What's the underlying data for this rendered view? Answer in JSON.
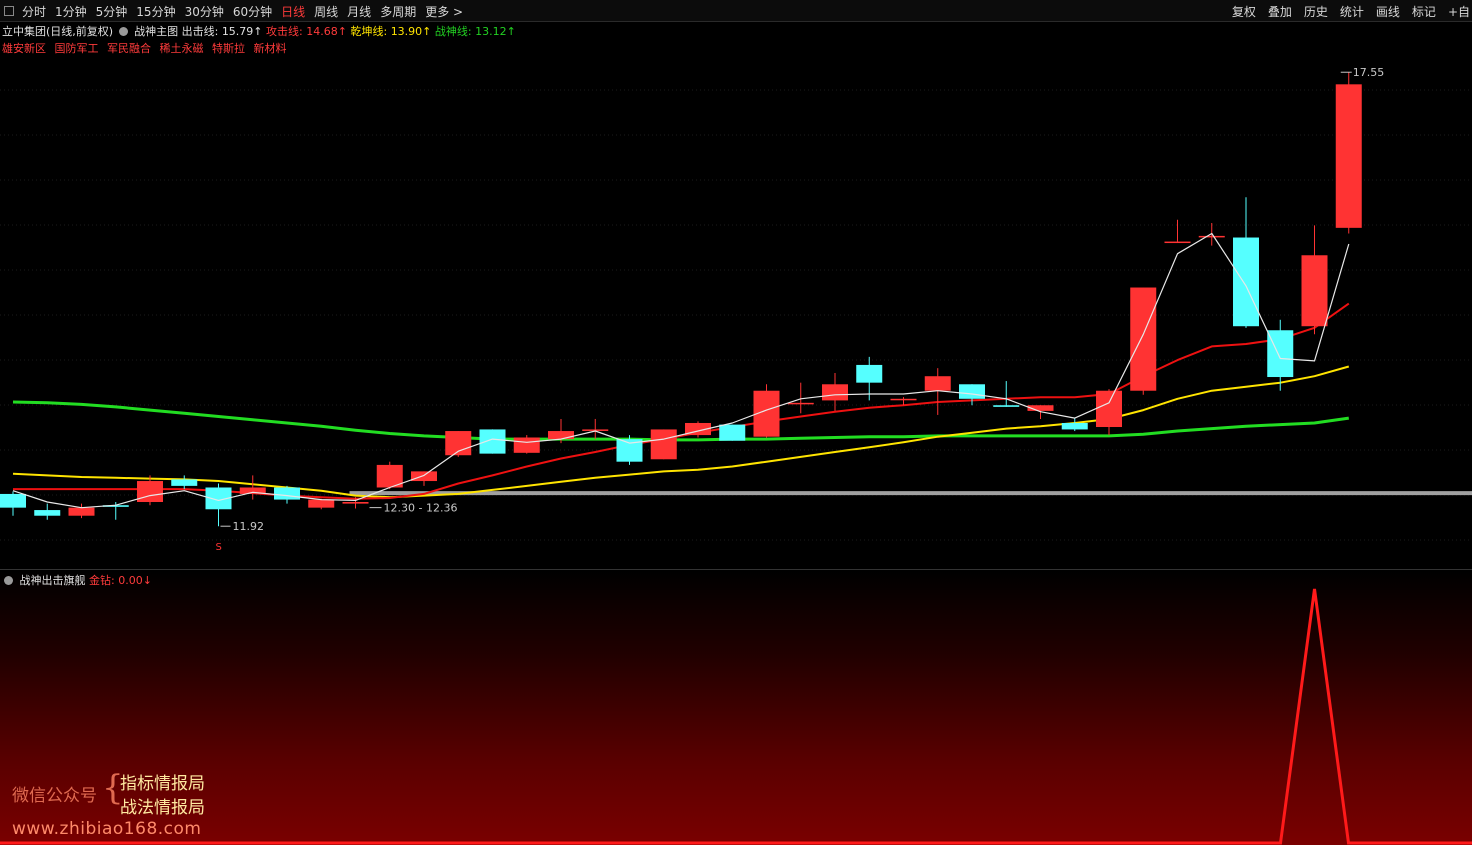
{
  "toolbar": {
    "periods": [
      "分时",
      "1分钟",
      "5分钟",
      "15分钟",
      "30分钟",
      "60分钟",
      "日线",
      "周线",
      "月线",
      "多周期",
      "更多 >"
    ],
    "active_period": "日线",
    "right_items": [
      "复权",
      "叠加",
      "历史",
      "统计",
      "画线",
      "标记",
      "+自"
    ]
  },
  "info": {
    "stock": "立中集团(日线,前复权)",
    "indicator": "战神主图",
    "out_label": "出击线:",
    "out_value": "15.79↑",
    "attack_label": "攻击线:",
    "attack_value": "14.68↑",
    "qiankun_label": "乾坤线:",
    "qiankun_value": "13.90↑",
    "zhanshen_label": "战神线:",
    "zhanshen_value": "13.12↑",
    "concepts": [
      "雄安新区",
      "国防军工",
      "军民融合",
      "稀土永磁",
      "特斯拉",
      "新材料"
    ]
  },
  "sub": {
    "title": "战神出击旗舰",
    "metric_label": "金钻:",
    "metric_value": "0.00↓"
  },
  "watermark": {
    "label": "微信公众号",
    "brace": "{",
    "line1": "指标情报局",
    "line2": "战法情报局",
    "url": "www.zhibiao168.com"
  },
  "chart_data": {
    "type": "candlestick",
    "y_range": [
      11.6,
      17.9
    ],
    "colors": {
      "up": "#ff3333",
      "down": "#55ffff",
      "ma_white": "#e8e8e8",
      "ma_red": "#ee1111",
      "ma_yellow": "#ffe400",
      "ma_green": "#22dd22",
      "support": "#a0a0a0"
    },
    "candles": [
      {
        "o": 12.32,
        "h": 12.35,
        "l": 12.05,
        "c": 12.15
      },
      {
        "o": 12.12,
        "h": 12.2,
        "l": 12.0,
        "c": 12.05
      },
      {
        "o": 12.05,
        "h": 12.2,
        "l": 12.02,
        "c": 12.15
      },
      {
        "o": 12.18,
        "h": 12.22,
        "l": 12.0,
        "c": 12.16
      },
      {
        "o": 12.22,
        "h": 12.55,
        "l": 12.18,
        "c": 12.48
      },
      {
        "o": 12.5,
        "h": 12.55,
        "l": 12.38,
        "c": 12.42
      },
      {
        "o": 12.4,
        "h": 12.45,
        "l": 11.92,
        "c": 12.13
      },
      {
        "o": 12.32,
        "h": 12.55,
        "l": 12.25,
        "c": 12.4
      },
      {
        "o": 12.4,
        "h": 12.42,
        "l": 12.2,
        "c": 12.25
      },
      {
        "o": 12.15,
        "h": 12.26,
        "l": 12.13,
        "c": 12.25
      },
      {
        "o": 12.2,
        "h": 12.28,
        "l": 12.14,
        "c": 12.22
      },
      {
        "o": 12.4,
        "h": 12.72,
        "l": 12.38,
        "c": 12.68
      },
      {
        "o": 12.48,
        "h": 12.6,
        "l": 12.42,
        "c": 12.6
      },
      {
        "o": 12.8,
        "h": 13.1,
        "l": 12.78,
        "c": 13.1
      },
      {
        "o": 13.12,
        "h": 13.12,
        "l": 12.82,
        "c": 12.82
      },
      {
        "o": 12.83,
        "h": 13.05,
        "l": 12.82,
        "c": 13.02
      },
      {
        "o": 13.0,
        "h": 13.25,
        "l": 12.95,
        "c": 13.1
      },
      {
        "o": 13.12,
        "h": 13.25,
        "l": 13.0,
        "c": 13.12
      },
      {
        "o": 13.0,
        "h": 13.05,
        "l": 12.68,
        "c": 12.72
      },
      {
        "o": 12.75,
        "h": 13.12,
        "l": 12.75,
        "c": 13.12
      },
      {
        "o": 13.05,
        "h": 13.22,
        "l": 13.02,
        "c": 13.2
      },
      {
        "o": 13.18,
        "h": 13.18,
        "l": 12.98,
        "c": 12.98
      },
      {
        "o": 13.03,
        "h": 13.68,
        "l": 13.02,
        "c": 13.6
      },
      {
        "o": 13.45,
        "h": 13.7,
        "l": 13.32,
        "c": 13.45
      },
      {
        "o": 13.48,
        "h": 13.82,
        "l": 13.35,
        "c": 13.68
      },
      {
        "o": 13.92,
        "h": 14.02,
        "l": 13.48,
        "c": 13.7
      },
      {
        "o": 13.5,
        "h": 13.52,
        "l": 13.42,
        "c": 13.5
      },
      {
        "o": 13.6,
        "h": 13.88,
        "l": 13.3,
        "c": 13.78
      },
      {
        "o": 13.68,
        "h": 13.68,
        "l": 13.42,
        "c": 13.5
      },
      {
        "o": 13.42,
        "h": 13.72,
        "l": 13.4,
        "c": 13.4
      },
      {
        "o": 13.35,
        "h": 13.42,
        "l": 13.25,
        "c": 13.42
      },
      {
        "o": 13.2,
        "h": 13.26,
        "l": 13.1,
        "c": 13.12
      },
      {
        "o": 13.15,
        "h": 13.62,
        "l": 13.05,
        "c": 13.6
      },
      {
        "o": 13.6,
        "h": 14.88,
        "l": 13.55,
        "c": 14.88
      },
      {
        "o": 15.45,
        "h": 15.72,
        "l": 15.45,
        "c": 15.45
      },
      {
        "o": 15.52,
        "h": 15.68,
        "l": 15.4,
        "c": 15.52
      },
      {
        "o": 15.5,
        "h": 16.0,
        "l": 14.38,
        "c": 14.4
      },
      {
        "o": 14.35,
        "h": 14.48,
        "l": 13.6,
        "c": 13.77
      },
      {
        "o": 14.4,
        "h": 15.65,
        "l": 14.3,
        "c": 15.28
      },
      {
        "o": 15.62,
        "h": 17.55,
        "l": 15.55,
        "c": 17.4
      }
    ],
    "ma_white": [
      12.36,
      12.22,
      12.15,
      12.18,
      12.3,
      12.36,
      12.24,
      12.34,
      12.3,
      12.25,
      12.24,
      12.4,
      12.55,
      12.85,
      13.0,
      12.96,
      13.0,
      13.1,
      12.95,
      13.0,
      13.1,
      13.2,
      13.36,
      13.5,
      13.55,
      13.56,
      13.56,
      13.6,
      13.56,
      13.5,
      13.34,
      13.26,
      13.45,
      14.3,
      15.3,
      15.55,
      14.9,
      14.0,
      13.97,
      15.42
    ],
    "ma_red": [
      12.38,
      12.38,
      12.38,
      12.38,
      12.38,
      12.38,
      12.36,
      12.33,
      12.3,
      12.28,
      12.26,
      12.27,
      12.32,
      12.45,
      12.55,
      12.66,
      12.76,
      12.84,
      12.93,
      13.0,
      13.08,
      13.15,
      13.22,
      13.28,
      13.34,
      13.39,
      13.42,
      13.46,
      13.48,
      13.5,
      13.52,
      13.52,
      13.56,
      13.78,
      13.98,
      14.15,
      14.18,
      14.24,
      14.38,
      14.68
    ],
    "ma_yellow": [
      12.57,
      12.55,
      12.53,
      12.52,
      12.51,
      12.5,
      12.48,
      12.44,
      12.4,
      12.36,
      12.3,
      12.28,
      12.3,
      12.32,
      12.37,
      12.42,
      12.47,
      12.52,
      12.56,
      12.6,
      12.62,
      12.66,
      12.72,
      12.78,
      12.84,
      12.9,
      12.96,
      13.03,
      13.08,
      13.13,
      13.16,
      13.2,
      13.25,
      13.36,
      13.5,
      13.6,
      13.65,
      13.7,
      13.78,
      13.9
    ],
    "ma_green": [
      13.46,
      13.45,
      13.43,
      13.4,
      13.36,
      13.32,
      13.28,
      13.24,
      13.2,
      13.16,
      13.11,
      13.07,
      13.04,
      13.02,
      13.0,
      13.0,
      13.0,
      13.0,
      13.0,
      12.99,
      12.99,
      13.0,
      13.0,
      13.01,
      13.02,
      13.03,
      13.03,
      13.04,
      13.04,
      13.04,
      13.04,
      13.04,
      13.04,
      13.06,
      13.1,
      13.13,
      13.16,
      13.18,
      13.2,
      13.26
    ],
    "support_level": 12.33,
    "annotations": [
      {
        "text": "12.30 - 12.36",
        "index": 10,
        "price": 12.2
      },
      {
        "text": "11.92",
        "index": 6,
        "price": 11.92
      },
      {
        "text": "17.55",
        "index": 39,
        "price": 17.55
      },
      {
        "text": "S",
        "index": 6,
        "price": 11.75
      }
    ],
    "sub_series": {
      "spike_index": 38,
      "spike_value": 1.0,
      "range": [
        0,
        1
      ]
    }
  }
}
